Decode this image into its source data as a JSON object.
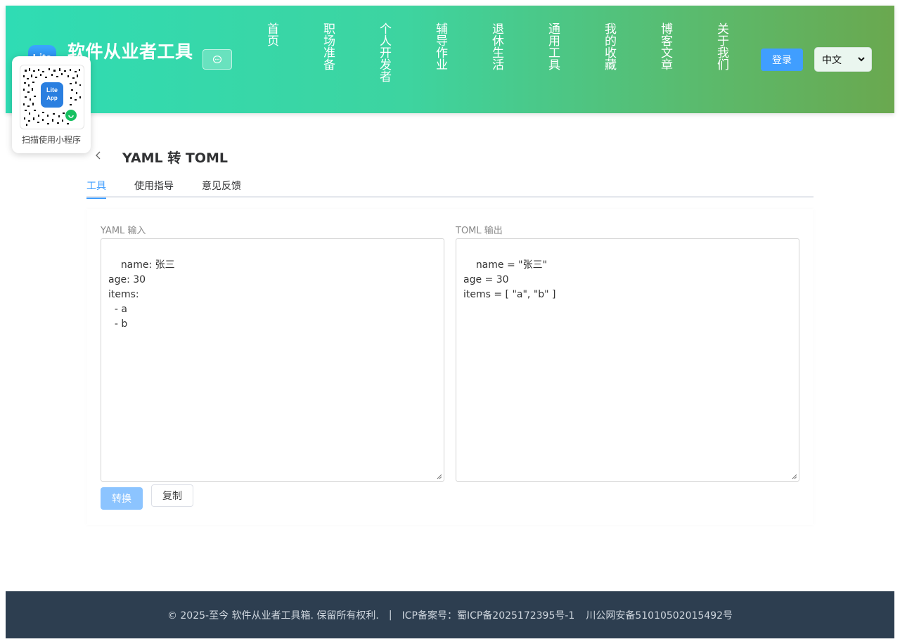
{
  "header": {
    "logo_text": "Lite",
    "brand_title": "软件从业者工具",
    "nav": [
      "首页",
      "职场准备",
      "个人开发者",
      "辅导作业",
      "退休生活",
      "通用工具",
      "我的收藏",
      "博客文章",
      "关于我们"
    ],
    "login_label": "登录",
    "language": "中文"
  },
  "qr_popup": {
    "badge_top": "Lite",
    "badge_bottom": "App",
    "caption": "扫描使用小程序"
  },
  "tool": {
    "title": "YAML 转 TOML",
    "tabs": [
      "工具",
      "使用指导",
      "意见反馈"
    ],
    "active_tab": 0,
    "input_label": "YAML 输入",
    "input_value": "name: 张三\nage: 30\nitems:\n  - a\n  - b",
    "output_label": "TOML 输出",
    "output_value": "name = \"张三\"\nage = 30\nitems = [ \"a\", \"b\" ]",
    "convert_label": "转换",
    "copy_label": "复制"
  },
  "footer": {
    "copyright": "© 2025-至今 软件从业者工具箱. 保留所有权利.",
    "separator": "|",
    "icp": "ICP备案号：蜀ICP备2025172395号-1",
    "police": "川公网安备51010502015492号"
  },
  "colors": {
    "header_gradient_start": "#2fdcb4",
    "header_gradient_end": "#6aa84f",
    "primary": "#409eff",
    "footer_bg": "#2d3e50"
  }
}
